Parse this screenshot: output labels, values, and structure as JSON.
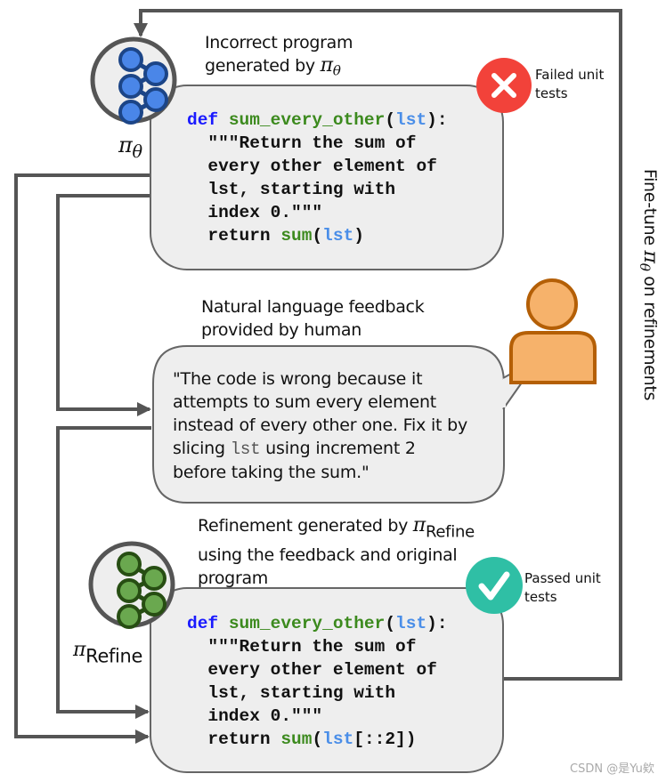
{
  "colors": {
    "policy_blue": "#4a86e8",
    "policy_blue_dark": "#1c4587",
    "refine_green": "#6aa84f",
    "refine_green_dark": "#274e13",
    "fail_red": "#f2423a",
    "pass_teal": "#2fbfa5",
    "human_orange": "#f6b26b",
    "human_outline": "#b45f06",
    "box_fill": "#eeeeee",
    "line": "#555555"
  },
  "icons": {
    "policy_model": "neural-network-icon",
    "fail": "x-mark-icon",
    "pass": "checkmark-icon",
    "human": "person-icon"
  },
  "top": {
    "caption_line1": "Incorrect program",
    "caption_line2": "generated by ",
    "caption_symbol": "π",
    "caption_sub": "θ",
    "model_label_symbol": "π",
    "model_label_sub": "θ",
    "status_line1": "Failed unit",
    "status_line2": "tests",
    "code": {
      "def": "def",
      "fn": "sum_every_other",
      "open": "(",
      "arg": "lst",
      "close": "):",
      "doc1": "\"\"\"Return the sum of",
      "doc2": "every other element of",
      "doc3": "lst, starting with",
      "doc4": "index 0.\"\"\"",
      "ret": "return ",
      "ret_fn": "sum",
      "ret_open": "(",
      "ret_arg": "lst",
      "ret_rest": ")"
    }
  },
  "feedback": {
    "caption_line1": "Natural language feedback",
    "caption_line2": "provided by human",
    "line1": "\"The code is wrong because it",
    "line2": "attempts to sum every element",
    "line3": "instead of every other one. Fix it by",
    "line4_pre": "slicing ",
    "line4_code": "lst",
    "line4_post": " using increment 2",
    "line5": "before taking the sum.\""
  },
  "refine": {
    "caption_line1": "Refinement generated by ",
    "caption_symbol": "π",
    "caption_sub": "Refine",
    "caption_line2": "using the feedback and original",
    "caption_line3": "program",
    "model_label_symbol": "π",
    "model_label_sub": "Refine",
    "status_line1": "Passed unit",
    "status_line2": "tests",
    "code": {
      "def": "def",
      "fn": "sum_every_other",
      "open": "(",
      "arg": "lst",
      "close": "):",
      "doc1": "\"\"\"Return the sum of",
      "doc2": "every other element of",
      "doc3": "lst, starting with",
      "doc4": "index 0.\"\"\"",
      "ret": "return ",
      "ret_fn": "sum",
      "ret_open": "(",
      "ret_arg": "lst",
      "ret_rest": "[::2])"
    }
  },
  "side": {
    "pre": "Fine-tune ",
    "symbol": "π",
    "sub": "θ",
    "post": " on refinements"
  },
  "watermark": "CSDN @是Yu欸"
}
